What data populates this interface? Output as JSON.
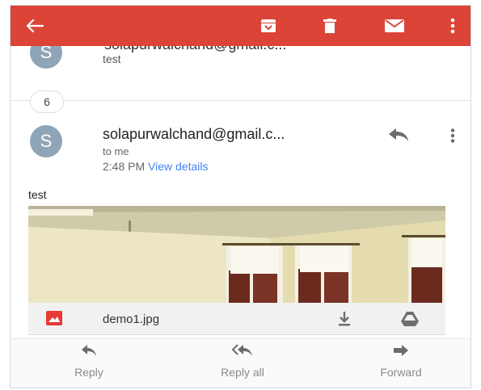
{
  "toolbar": {
    "icons": [
      "back-arrow-icon",
      "archive-icon",
      "trash-icon",
      "mail-icon",
      "more-vert-icon"
    ],
    "color": "#db4437"
  },
  "previous_message": {
    "avatar_letter": "S",
    "sender": "solapurwalchand@gmail.c...",
    "snippet": "test"
  },
  "collapsed_count": "6",
  "message": {
    "avatar_letter": "S",
    "sender": "solapurwalchand@gmail.c...",
    "recipient": "to me",
    "time": "2:48 PM",
    "details_link": "View details",
    "body": "test"
  },
  "attachment": {
    "name": "demo1.jpg"
  },
  "actions": {
    "reply": "Reply",
    "reply_all": "Reply all",
    "forward": "Forward"
  },
  "colors": {
    "avatar": "#8fa5b7",
    "link": "#4285f4",
    "attachment_icon": "#e53935"
  }
}
